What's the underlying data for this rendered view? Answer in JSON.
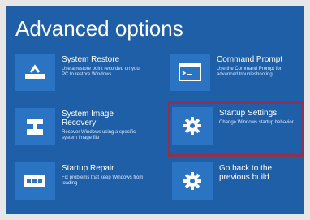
{
  "page": {
    "title": "Advanced options"
  },
  "options": [
    {
      "title": "System Restore",
      "description": "Use a restore point recorded on your PC to restore Windows",
      "icon": "system-restore-icon"
    },
    {
      "title": "Command Prompt",
      "description": "Use the Command Prompt for advanced troubleshooting",
      "icon": "command-prompt-icon"
    },
    {
      "title": "System Image Recovery",
      "description": "Recover Windows using a specific system image file",
      "icon": "system-image-recovery-icon"
    },
    {
      "title": "Startup Settings",
      "description": "Change Windows startup behavior",
      "icon": "gear-icon"
    },
    {
      "title": "Startup Repair",
      "description": "Fix problems that keep Windows from loading",
      "icon": "startup-repair-icon"
    },
    {
      "title": "Go back to the previous build",
      "description": "",
      "icon": "gear-icon"
    }
  ],
  "colors": {
    "background": "#1f5fa8",
    "tile": "#2b73c3",
    "highlight": "#8f3250",
    "text": "#ffffff"
  }
}
